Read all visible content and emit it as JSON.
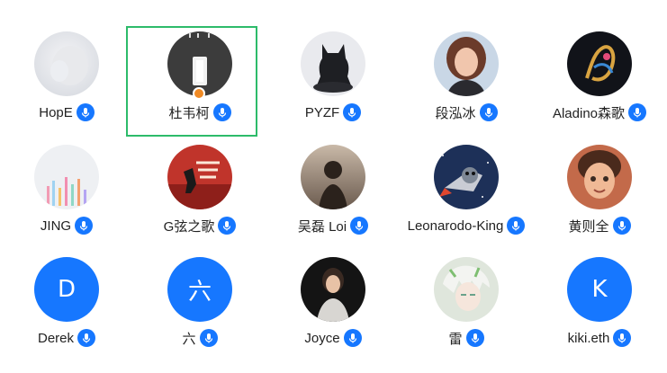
{
  "participants": [
    {
      "name": "HopE",
      "avatar": "photo-misty-white"
    },
    {
      "name": "杜韦柯",
      "avatar": "phone-camera-dark",
      "host": true,
      "selected": true
    },
    {
      "name": "PYZF",
      "avatar": "black-dog-figure"
    },
    {
      "name": "段泓冰",
      "avatar": "cartoon-girl-portrait"
    },
    {
      "name": "Aladino森歌",
      "avatar": "neon-abstract-dark"
    },
    {
      "name": "JING",
      "avatar": "pastel-city-lights"
    },
    {
      "name": "G弦之歌",
      "avatar": "red-poster-silhouette"
    },
    {
      "name": "吴磊 Loi",
      "avatar": "sunset-silhouette"
    },
    {
      "name": "Leonarodo-King",
      "avatar": "space-cat-rocket"
    },
    {
      "name": "黄则全",
      "avatar": "3d-cartoon-boy"
    },
    {
      "name": "Derek",
      "avatar": "letter",
      "letter": "D"
    },
    {
      "name": "六",
      "avatar": "letter",
      "letter": "六"
    },
    {
      "name": "Joyce",
      "avatar": "woman-dark-background"
    },
    {
      "name": "雷",
      "avatar": "anime-white-hair"
    },
    {
      "name": "kiki.eth",
      "avatar": "letter",
      "letter": "K"
    }
  ],
  "colors": {
    "mic_blue": "#1677ff",
    "selected_border": "#2dbb6a",
    "host_badge": "#f08a24"
  },
  "icons": {
    "mic": "microphone-icon",
    "host": "host-person-icon"
  }
}
